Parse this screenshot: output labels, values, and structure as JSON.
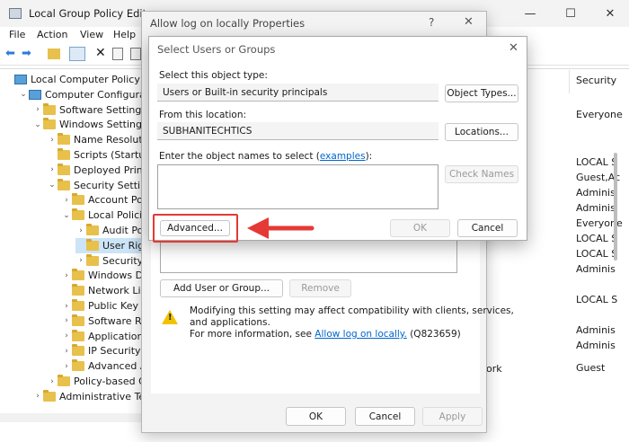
{
  "main_window": {
    "title": "Local Group Policy Editor",
    "menu": [
      "File",
      "Action",
      "View",
      "Help"
    ],
    "column_header": "Security",
    "tree": [
      {
        "label": "Local Computer Policy",
        "indent": 0,
        "chev": "",
        "icon": "pc"
      },
      {
        "label": "Computer Configuration",
        "indent": 1,
        "chev": "v",
        "icon": "pc"
      },
      {
        "label": "Software Settings",
        "indent": 2,
        "chev": ">",
        "icon": "folder"
      },
      {
        "label": "Windows Settings",
        "indent": 2,
        "chev": "v",
        "icon": "folder"
      },
      {
        "label": "Name Resolution",
        "indent": 3,
        "chev": ">",
        "icon": "folder"
      },
      {
        "label": "Scripts (Startup/",
        "indent": 3,
        "chev": "",
        "icon": "folder"
      },
      {
        "label": "Deployed Printer",
        "indent": 3,
        "chev": ">",
        "icon": "folder"
      },
      {
        "label": "Security Settings",
        "indent": 3,
        "chev": "v",
        "icon": "folder"
      },
      {
        "label": "Account Polic",
        "indent": 4,
        "chev": ">",
        "icon": "folder"
      },
      {
        "label": "Local Policie",
        "indent": 4,
        "chev": "v",
        "icon": "folder"
      },
      {
        "label": "Audit Pol",
        "indent": 5,
        "chev": ">",
        "icon": "folder"
      },
      {
        "label": "User Righ",
        "indent": 5,
        "chev": "",
        "icon": "folder"
      },
      {
        "label": "Security",
        "indent": 5,
        "chev": ">",
        "icon": "folder"
      },
      {
        "label": "Windows De",
        "indent": 4,
        "chev": ">",
        "icon": "folder"
      },
      {
        "label": "Network List",
        "indent": 4,
        "chev": "",
        "icon": "folder"
      },
      {
        "label": "Public Key Po",
        "indent": 4,
        "chev": ">",
        "icon": "folder"
      },
      {
        "label": "Software Res",
        "indent": 4,
        "chev": ">",
        "icon": "folder"
      },
      {
        "label": "Application C",
        "indent": 4,
        "chev": ">",
        "icon": "folder"
      },
      {
        "label": "IP Security P",
        "indent": 4,
        "chev": ">",
        "icon": "folder"
      },
      {
        "label": "Advanced A",
        "indent": 4,
        "chev": ">",
        "icon": "folder"
      },
      {
        "label": "Policy-based Qo",
        "indent": 3,
        "chev": ">",
        "icon": "folder"
      },
      {
        "label": "Administrative Temp",
        "indent": 2,
        "chev": ">",
        "icon": "folder"
      }
    ],
    "right_column": [
      "Everyone",
      "LOCAL S",
      "Guest,Ac",
      "Adminis",
      "Adminis",
      "Everyone",
      "LOCAL S",
      "LOCAL S",
      "Adminis",
      "LOCAL S",
      "Adminis",
      "Adminis",
      "Guest"
    ],
    "right_extra": "ork"
  },
  "properties_dialog": {
    "title": "Allow log on locally Properties",
    "add_user_button": "Add User or Group...",
    "remove_button": "Remove",
    "warning_line1": "Modifying this setting may affect compatibility with clients, services,",
    "warning_line2": "and applications.",
    "more_info_prefix": "For more information, see ",
    "more_info_link": "Allow log on locally.",
    "more_info_suffix": " (Q823659)",
    "ok": "OK",
    "cancel": "Cancel",
    "apply": "Apply",
    "help": "?"
  },
  "select_dialog": {
    "title": "Select Users or Groups",
    "object_type_label": "Select this object type:",
    "object_type_value": "Users or Built-in security principals",
    "object_types_button": "Object Types...",
    "location_label": "From this location:",
    "location_value": "SUBHANITECHTICS",
    "locations_button": "Locations...",
    "names_label_prefix": "Enter the object names to select (",
    "names_label_link": "examples",
    "names_label_suffix": "):",
    "check_names_button": "Check Names",
    "advanced_button": "Advanced...",
    "ok": "OK",
    "cancel": "Cancel"
  },
  "colors": {
    "highlight_red": "#e53935",
    "link_blue": "#0066cc",
    "folder_yellow": "#e8c04c"
  }
}
